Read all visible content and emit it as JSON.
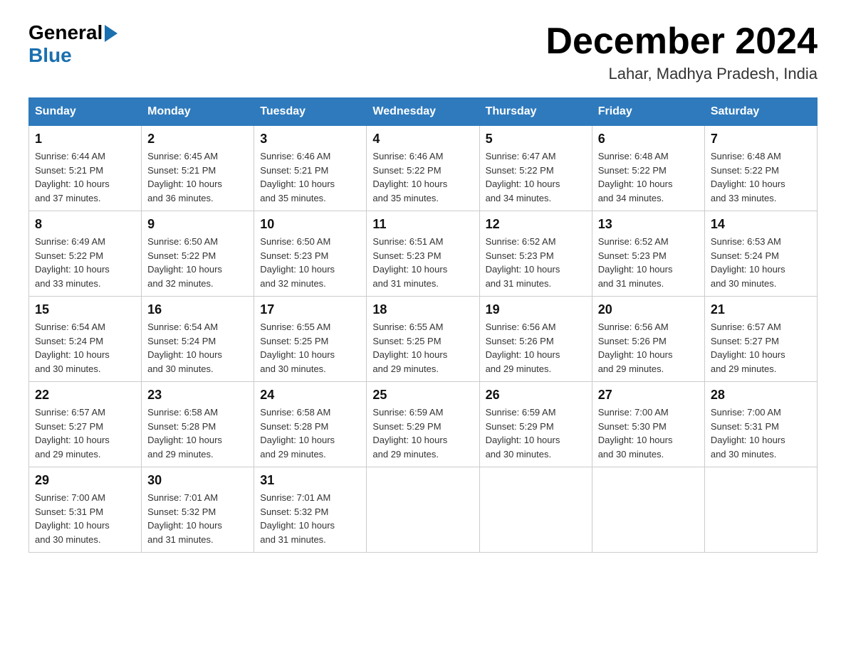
{
  "logo": {
    "text_general": "General",
    "text_blue": "Blue",
    "aria": "GeneralBlue logo"
  },
  "title": "December 2024",
  "subtitle": "Lahar, Madhya Pradesh, India",
  "days_of_week": [
    "Sunday",
    "Monday",
    "Tuesday",
    "Wednesday",
    "Thursday",
    "Friday",
    "Saturday"
  ],
  "weeks": [
    [
      {
        "day": "1",
        "sunrise": "6:44 AM",
        "sunset": "5:21 PM",
        "daylight": "10 hours and 37 minutes."
      },
      {
        "day": "2",
        "sunrise": "6:45 AM",
        "sunset": "5:21 PM",
        "daylight": "10 hours and 36 minutes."
      },
      {
        "day": "3",
        "sunrise": "6:46 AM",
        "sunset": "5:21 PM",
        "daylight": "10 hours and 35 minutes."
      },
      {
        "day": "4",
        "sunrise": "6:46 AM",
        "sunset": "5:22 PM",
        "daylight": "10 hours and 35 minutes."
      },
      {
        "day": "5",
        "sunrise": "6:47 AM",
        "sunset": "5:22 PM",
        "daylight": "10 hours and 34 minutes."
      },
      {
        "day": "6",
        "sunrise": "6:48 AM",
        "sunset": "5:22 PM",
        "daylight": "10 hours and 34 minutes."
      },
      {
        "day": "7",
        "sunrise": "6:48 AM",
        "sunset": "5:22 PM",
        "daylight": "10 hours and 33 minutes."
      }
    ],
    [
      {
        "day": "8",
        "sunrise": "6:49 AM",
        "sunset": "5:22 PM",
        "daylight": "10 hours and 33 minutes."
      },
      {
        "day": "9",
        "sunrise": "6:50 AM",
        "sunset": "5:22 PM",
        "daylight": "10 hours and 32 minutes."
      },
      {
        "day": "10",
        "sunrise": "6:50 AM",
        "sunset": "5:23 PM",
        "daylight": "10 hours and 32 minutes."
      },
      {
        "day": "11",
        "sunrise": "6:51 AM",
        "sunset": "5:23 PM",
        "daylight": "10 hours and 31 minutes."
      },
      {
        "day": "12",
        "sunrise": "6:52 AM",
        "sunset": "5:23 PM",
        "daylight": "10 hours and 31 minutes."
      },
      {
        "day": "13",
        "sunrise": "6:52 AM",
        "sunset": "5:23 PM",
        "daylight": "10 hours and 31 minutes."
      },
      {
        "day": "14",
        "sunrise": "6:53 AM",
        "sunset": "5:24 PM",
        "daylight": "10 hours and 30 minutes."
      }
    ],
    [
      {
        "day": "15",
        "sunrise": "6:54 AM",
        "sunset": "5:24 PM",
        "daylight": "10 hours and 30 minutes."
      },
      {
        "day": "16",
        "sunrise": "6:54 AM",
        "sunset": "5:24 PM",
        "daylight": "10 hours and 30 minutes."
      },
      {
        "day": "17",
        "sunrise": "6:55 AM",
        "sunset": "5:25 PM",
        "daylight": "10 hours and 30 minutes."
      },
      {
        "day": "18",
        "sunrise": "6:55 AM",
        "sunset": "5:25 PM",
        "daylight": "10 hours and 29 minutes."
      },
      {
        "day": "19",
        "sunrise": "6:56 AM",
        "sunset": "5:26 PM",
        "daylight": "10 hours and 29 minutes."
      },
      {
        "day": "20",
        "sunrise": "6:56 AM",
        "sunset": "5:26 PM",
        "daylight": "10 hours and 29 minutes."
      },
      {
        "day": "21",
        "sunrise": "6:57 AM",
        "sunset": "5:27 PM",
        "daylight": "10 hours and 29 minutes."
      }
    ],
    [
      {
        "day": "22",
        "sunrise": "6:57 AM",
        "sunset": "5:27 PM",
        "daylight": "10 hours and 29 minutes."
      },
      {
        "day": "23",
        "sunrise": "6:58 AM",
        "sunset": "5:28 PM",
        "daylight": "10 hours and 29 minutes."
      },
      {
        "day": "24",
        "sunrise": "6:58 AM",
        "sunset": "5:28 PM",
        "daylight": "10 hours and 29 minutes."
      },
      {
        "day": "25",
        "sunrise": "6:59 AM",
        "sunset": "5:29 PM",
        "daylight": "10 hours and 29 minutes."
      },
      {
        "day": "26",
        "sunrise": "6:59 AM",
        "sunset": "5:29 PM",
        "daylight": "10 hours and 30 minutes."
      },
      {
        "day": "27",
        "sunrise": "7:00 AM",
        "sunset": "5:30 PM",
        "daylight": "10 hours and 30 minutes."
      },
      {
        "day": "28",
        "sunrise": "7:00 AM",
        "sunset": "5:31 PM",
        "daylight": "10 hours and 30 minutes."
      }
    ],
    [
      {
        "day": "29",
        "sunrise": "7:00 AM",
        "sunset": "5:31 PM",
        "daylight": "10 hours and 30 minutes."
      },
      {
        "day": "30",
        "sunrise": "7:01 AM",
        "sunset": "5:32 PM",
        "daylight": "10 hours and 31 minutes."
      },
      {
        "day": "31",
        "sunrise": "7:01 AM",
        "sunset": "5:32 PM",
        "daylight": "10 hours and 31 minutes."
      },
      null,
      null,
      null,
      null
    ]
  ],
  "labels": {
    "sunrise": "Sunrise: ",
    "sunset": "Sunset: ",
    "daylight": "Daylight: "
  }
}
